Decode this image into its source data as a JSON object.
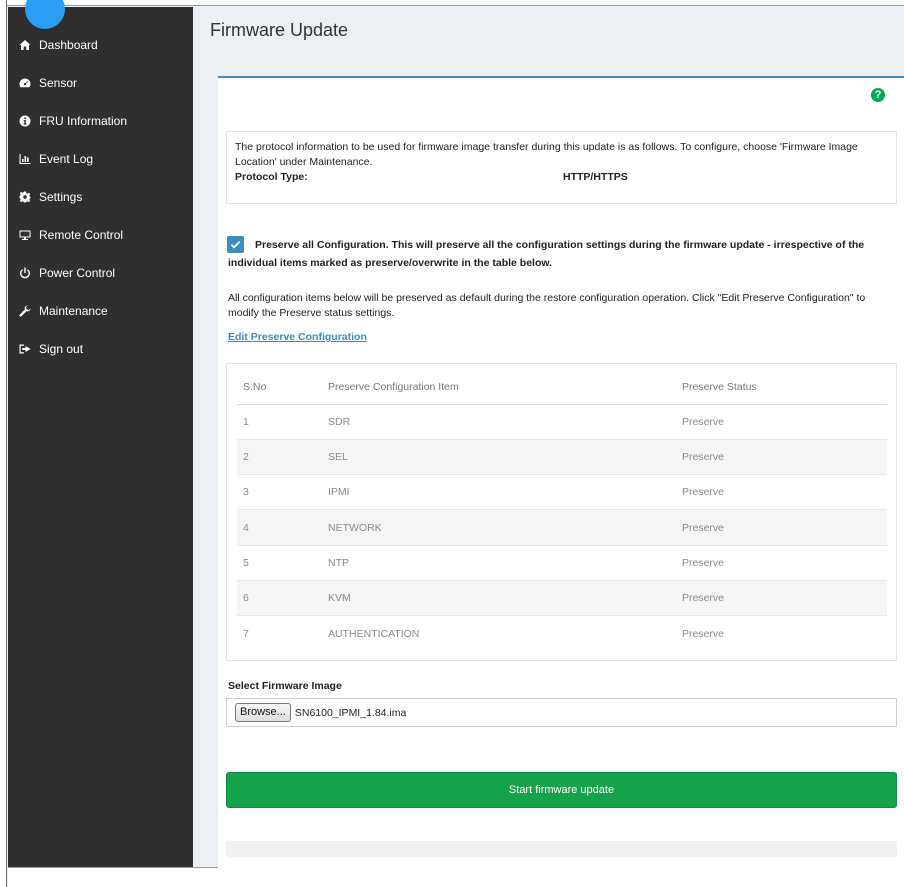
{
  "sidebar": {
    "items": [
      {
        "label": "Dashboard",
        "icon": "home-icon"
      },
      {
        "label": "Sensor",
        "icon": "tachometer-icon"
      },
      {
        "label": "FRU Information",
        "icon": "info-circle-icon"
      },
      {
        "label": "Event Log",
        "icon": "bar-chart-icon"
      },
      {
        "label": "Settings",
        "icon": "gear-icon"
      },
      {
        "label": "Remote Control",
        "icon": "monitor-icon"
      },
      {
        "label": "Power Control",
        "icon": "power-icon"
      },
      {
        "label": "Maintenance",
        "icon": "wrench-icon"
      },
      {
        "label": "Sign out",
        "icon": "sign-out-icon"
      }
    ]
  },
  "page": {
    "title": "Firmware Update",
    "help_glyph": "?"
  },
  "protocol": {
    "description": "The protocol information to be used for firmware image transfer during this update is as follows. To configure, choose 'Firmware Image Location' under Maintenance.",
    "type_label": "Protocol Type:",
    "type_value": "HTTP/HTTPS"
  },
  "preserve": {
    "checked": true,
    "text": "Preserve all Configuration. This will preserve all the configuration settings during the firmware update - irrespective of the individual items marked as preserve/overwrite in the table below.",
    "info": "All configuration items below will be preserved as default during the restore configuration operation. Click \"Edit Preserve Configuration\" to modify the Preserve status settings.",
    "edit_link": "Edit Preserve Configuration"
  },
  "table": {
    "headers": [
      "S.No",
      "Preserve Configuration Item",
      "Preserve Status"
    ],
    "rows": [
      [
        "1",
        "SDR",
        "Preserve"
      ],
      [
        "2",
        "SEL",
        "Preserve"
      ],
      [
        "3",
        "IPMI",
        "Preserve"
      ],
      [
        "4",
        "NETWORK",
        "Preserve"
      ],
      [
        "5",
        "NTP",
        "Preserve"
      ],
      [
        "6",
        "KVM",
        "Preserve"
      ],
      [
        "7",
        "AUTHENTICATION",
        "Preserve"
      ]
    ]
  },
  "firmware": {
    "select_label": "Select Firmware Image",
    "browse_label": "Browse...",
    "file_name": "SN6100_IPMI_1.84.ima",
    "start_label": "Start firmware update",
    "progress_percent": 0
  },
  "colors": {
    "sidebar_bg": "#2f2f2f",
    "accent": "#3c8dbc",
    "success": "#16a14b"
  }
}
